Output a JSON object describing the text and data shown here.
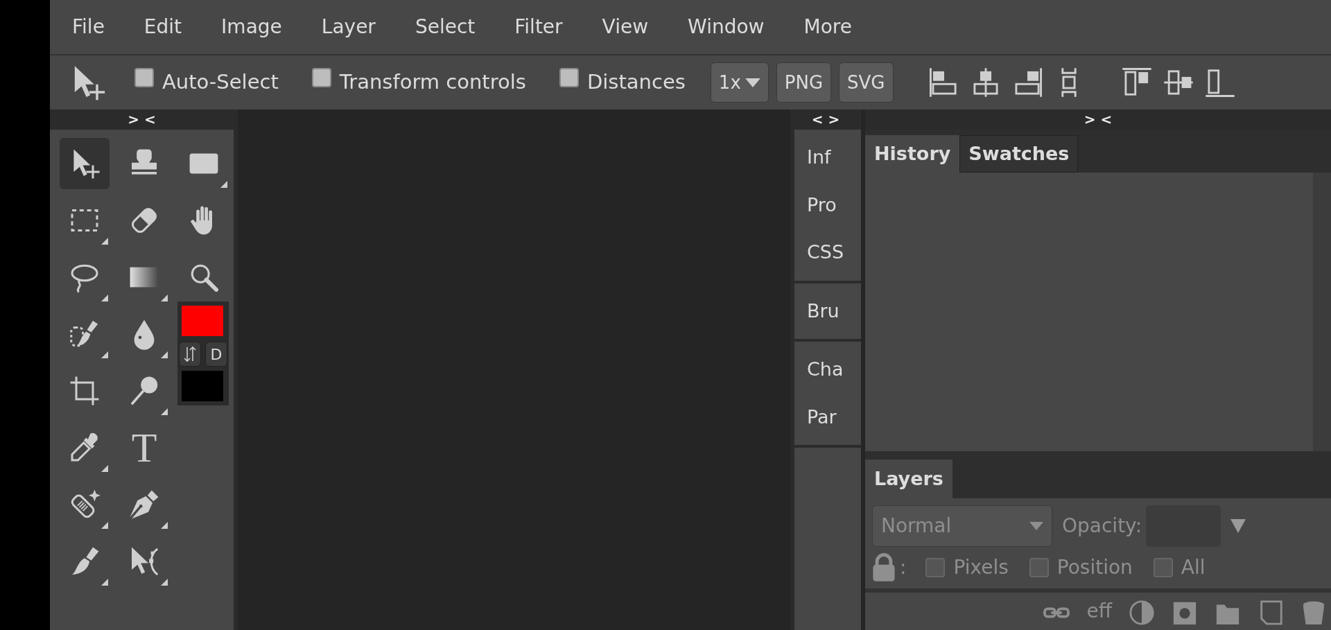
{
  "menu": [
    "File",
    "Edit",
    "Image",
    "Layer",
    "Select",
    "Filter",
    "View",
    "Window",
    "More"
  ],
  "options_bar": {
    "checkboxes": [
      {
        "label": "Auto-Select",
        "checked": false
      },
      {
        "label": "Transform controls",
        "checked": false
      },
      {
        "label": "Distances",
        "checked": false
      }
    ],
    "scale": "1x",
    "export_buttons": [
      "PNG",
      "SVG"
    ]
  },
  "tools_panel": {
    "collapse": "> <",
    "tools": [
      {
        "kind": "move",
        "selected": true,
        "more": false
      },
      {
        "kind": "stamp",
        "selected": false,
        "more": false
      },
      {
        "kind": "shape",
        "selected": false,
        "more": true
      },
      {
        "kind": "marquee",
        "selected": false,
        "more": true
      },
      {
        "kind": "eraser",
        "selected": false,
        "more": false
      },
      {
        "kind": "hand",
        "selected": false,
        "more": false
      },
      {
        "kind": "lasso",
        "selected": false,
        "more": true
      },
      {
        "kind": "gradient",
        "selected": false,
        "more": true
      },
      {
        "kind": "zoom",
        "selected": false,
        "more": false
      },
      {
        "kind": "quickselect",
        "selected": false,
        "more": true
      },
      {
        "kind": "drop",
        "selected": false,
        "more": true
      },
      {
        "kind": "crop",
        "selected": false,
        "more": false
      },
      {
        "kind": "dodge",
        "selected": false,
        "more": true
      },
      {
        "kind": "eyedropper",
        "selected": false,
        "more": true
      },
      {
        "kind": "type",
        "label": "T",
        "selected": false,
        "more": false
      },
      {
        "kind": "healing",
        "selected": false,
        "more": true
      },
      {
        "kind": "pen",
        "selected": false,
        "more": true
      },
      {
        "kind": "brush",
        "selected": false,
        "more": true
      },
      {
        "kind": "pathselect",
        "selected": false,
        "more": true
      }
    ],
    "colors": {
      "foreground": {
        "color": "#ff0000"
      },
      "background": {
        "color": "#000000"
      },
      "default_label": "D"
    }
  },
  "collapsed_panels": {
    "collapse": "< >",
    "groups": [
      [
        "Inf",
        "Pro",
        "CSS"
      ],
      [
        "Bru"
      ],
      [
        "Cha",
        "Par"
      ]
    ]
  },
  "right_panel": {
    "collapse": "> <",
    "tabs": [
      {
        "label": "History",
        "selected": true
      },
      {
        "label": "Swatches",
        "selected": false
      }
    ],
    "layers": {
      "tab": "Layers",
      "blend_mode": "Normal",
      "opacity_label": "Opacity:",
      "lock_separator": ":",
      "locks": [
        {
          "label": "Pixels",
          "checked": false
        },
        {
          "label": "Position",
          "checked": false
        },
        {
          "label": "All",
          "checked": false
        }
      ],
      "effects_label": "eff"
    }
  }
}
